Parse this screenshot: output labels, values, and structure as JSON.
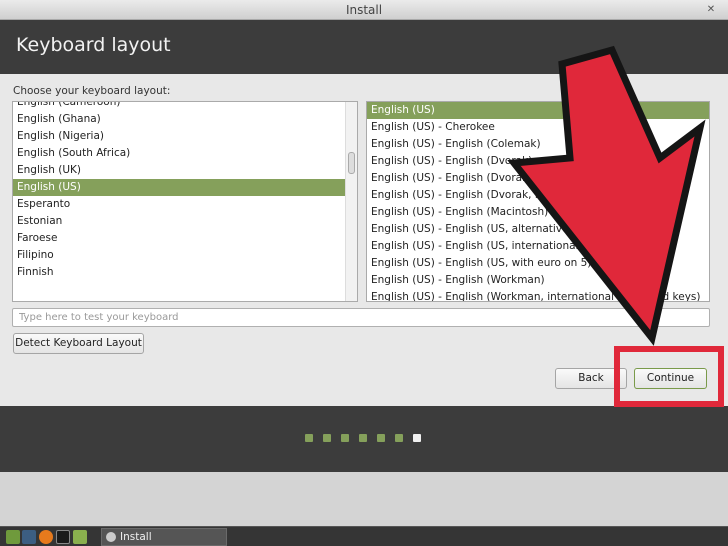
{
  "window": {
    "title": "Install"
  },
  "header": {
    "title": "Keyboard layout"
  },
  "prompt": "Choose your keyboard layout:",
  "layouts": [
    "English (Cameroon)",
    "English (Ghana)",
    "English (Nigeria)",
    "English (South Africa)",
    "English (UK)",
    "English (US)",
    "Esperanto",
    "Estonian",
    "Faroese",
    "Filipino",
    "Finnish"
  ],
  "layouts_selected": "English (US)",
  "variants": [
    "English (US)",
    "English (US) - Cherokee",
    "English (US) - English (Colemak)",
    "English (US) - English (Dvorak)",
    "English (US) - English (Dvorak)",
    "English (US) - English (Dvorak, international)",
    "English (US) - English (Macintosh)",
    "English (US) - English (US, alternative international)",
    "English (US) - English (US, international with dead keys)",
    "English (US) - English (US, with euro on 5)",
    "English (US) - English (Workman)",
    "English (US) - English (Workman, international with dead keys)"
  ],
  "variants_selected": "English (US)",
  "test_placeholder": "Type here to test your keyboard",
  "buttons": {
    "detect": "Detect Keyboard Layout",
    "back": "Back",
    "continue": "Continue"
  },
  "progress": {
    "total_steps": 7,
    "current_step": 7
  },
  "taskbar": {
    "task_label": "Install"
  },
  "annotation": {
    "arrow_color": "#e0283a",
    "highlight_color": "#e0283a"
  }
}
